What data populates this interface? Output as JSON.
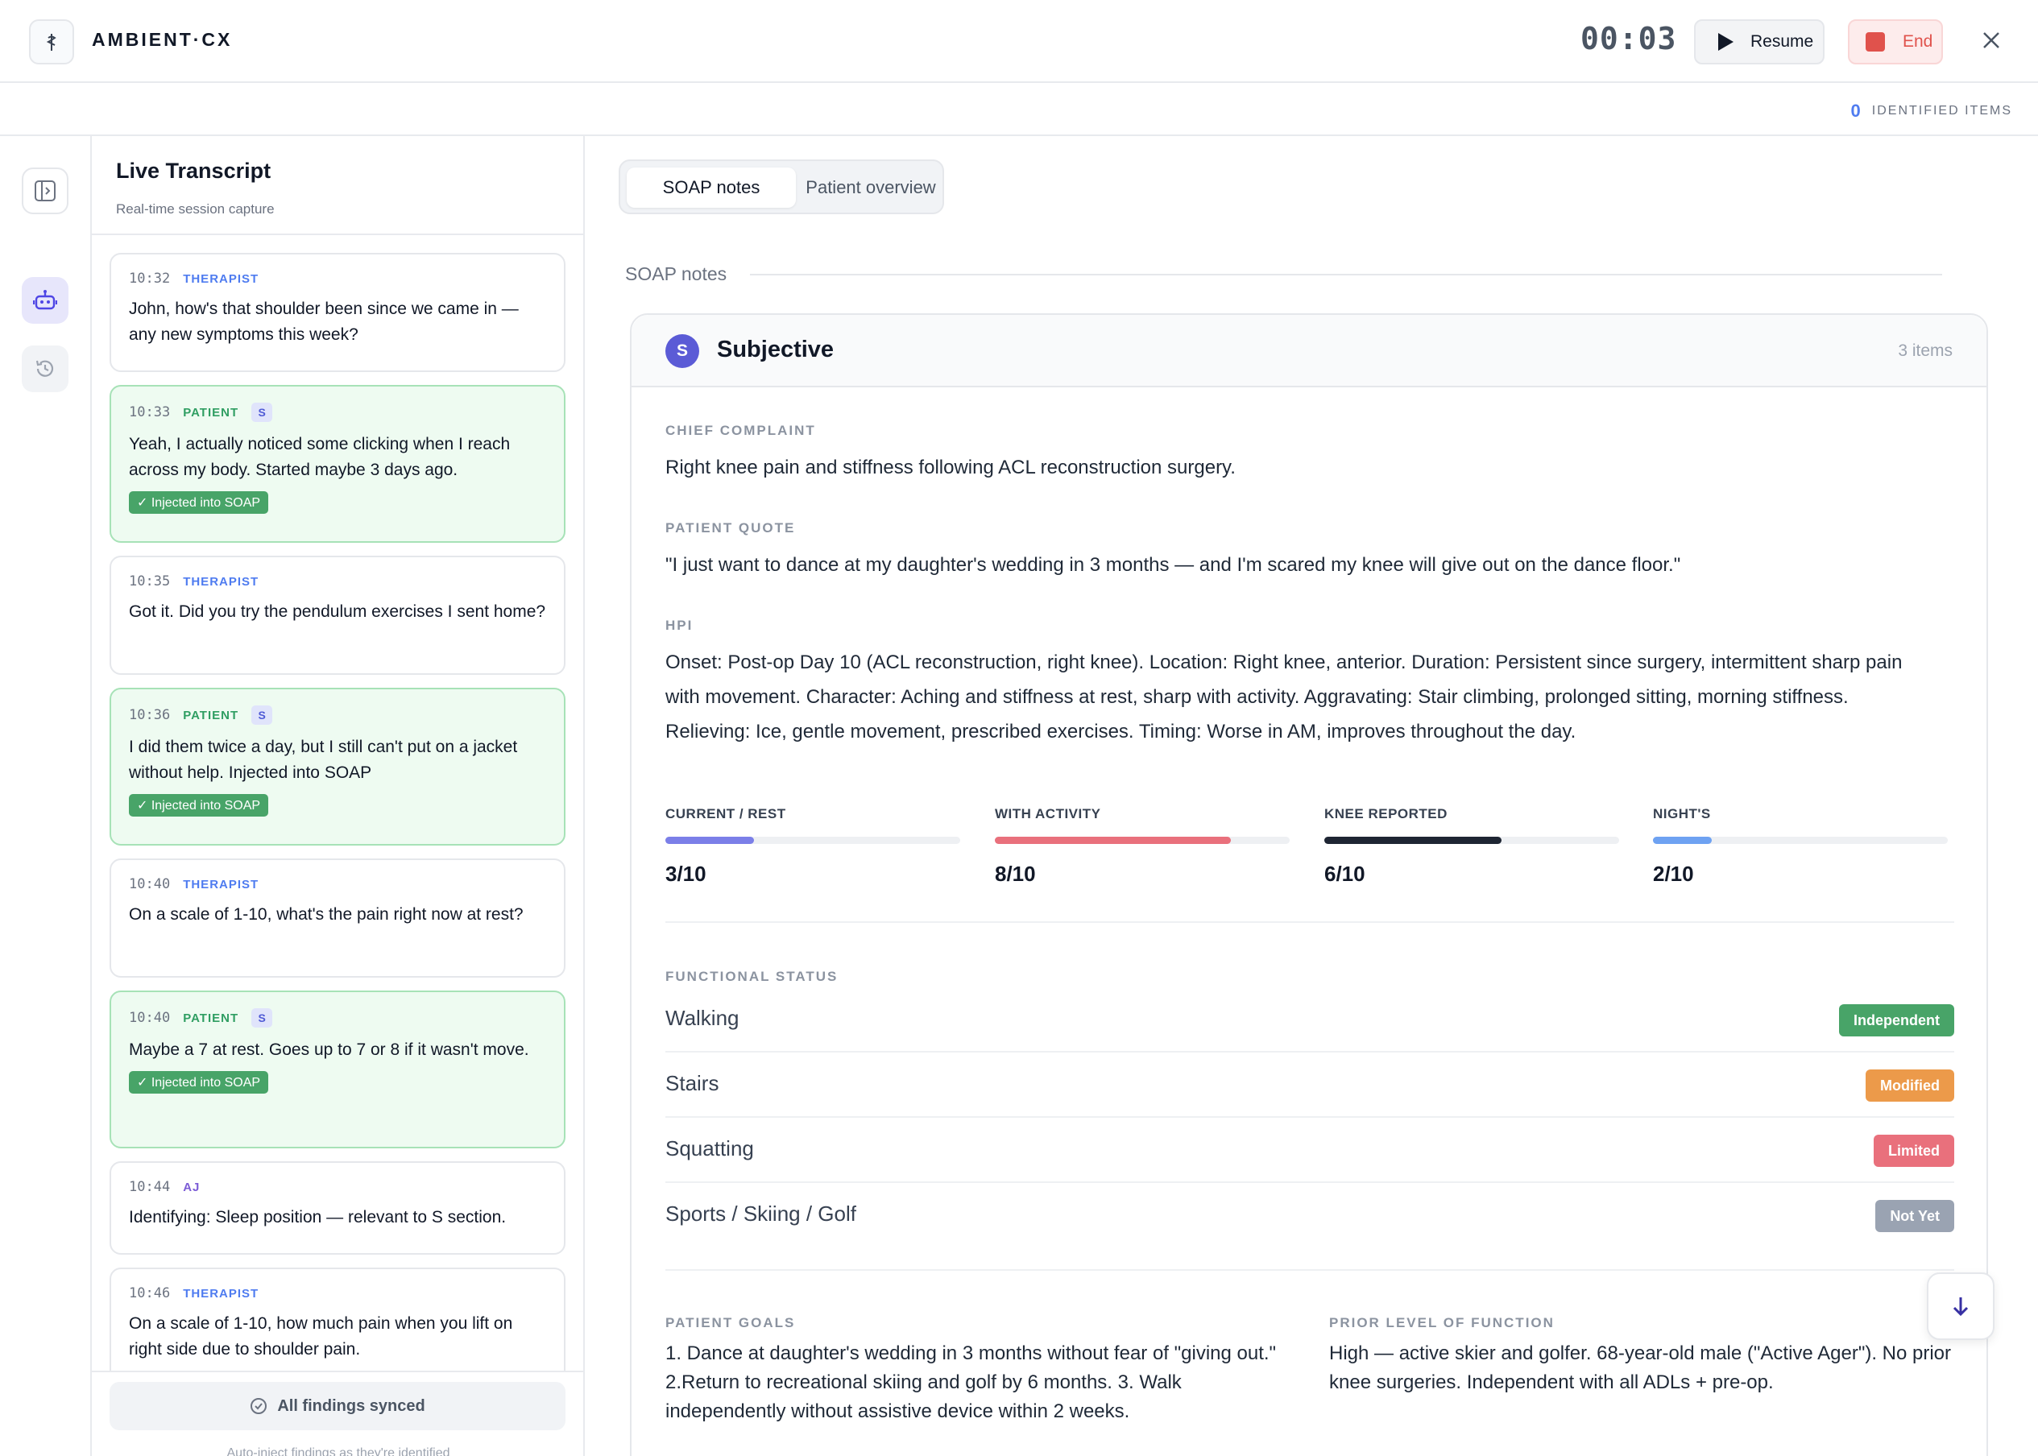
{
  "header": {
    "brand": "AMBIENT·CX",
    "timer": "00:03",
    "resume_label": "Resume",
    "end_label": "End",
    "identified_count": "0",
    "identified_label": "IDENTIFIED ITEMS"
  },
  "transcript": {
    "title": "Live Transcript",
    "subtitle": "Real-time session capture",
    "messages": [
      {
        "time": "10:32",
        "role": "THERAPIST",
        "text": "John, how's that shoulder been since we came in — any new symptoms this week?"
      },
      {
        "time": "10:33",
        "role": "PATIENT",
        "chip": "S",
        "text": "Yeah, I actually noticed some clicking when I reach across my body. Started maybe 3 days ago.",
        "injected": "✓ Injected into SOAP"
      },
      {
        "time": "10:35",
        "role": "THERAPIST",
        "text": "Got it. Did you try the pendulum exercises I sent home?"
      },
      {
        "time": "10:36",
        "role": "PATIENT",
        "chip": "S",
        "text": "I did them twice a day, but I still can't put on a jacket without help. Injected into SOAP",
        "injected": "✓ Injected into SOAP"
      },
      {
        "time": "10:40",
        "role": "THERAPIST",
        "text": "On a scale of 1-10, what's the pain right now at rest?"
      },
      {
        "time": "10:40",
        "role": "PATIENT",
        "chip": "S",
        "text": "Maybe a 7 at rest. Goes up to 7 or 8 if it wasn't move.",
        "injected": "✓ Injected into SOAP"
      },
      {
        "time": "10:44",
        "role": "AJ",
        "text": "Identifying: Sleep position — relevant to S section."
      },
      {
        "time": "10:46",
        "role": "THERAPIST",
        "text": "On a scale of 1-10, how much pain when you lift on right side due to shoulder pain."
      }
    ],
    "synced_label": "All findings synced",
    "footer_note": "Auto-inject findings as they're identified"
  },
  "tabs": {
    "soap": "SOAP notes",
    "overview": "Patient overview"
  },
  "main": {
    "section_label": "SOAP notes",
    "card": {
      "badge_letter": "S",
      "title": "Subjective",
      "count": "3 items",
      "chief_complaint_label": "CHIEF COMPLAINT",
      "chief_complaint": "Right knee pain and stiffness following ACL reconstruction surgery.",
      "patient_quote_label": "PATIENT QUOTE",
      "patient_quote": "\"I just want to dance at my daughter's wedding in 3 months — and I'm scared my knee will give out on the dance floor.\"",
      "hpi_label": "HPI",
      "hpi": "Onset: Post-op Day 10 (ACL reconstruction, right knee). Location: Right knee, anterior. Duration: Persistent since surgery, intermittent sharp pain with movement. Character: Aching and stiffness at rest, sharp with activity. Aggravating: Stair climbing, prolonged sitting, morning stiffness. Relieving: Ice, gentle movement, prescribed exercises. Timing: Worse in AM, improves throughout the day.",
      "pain": [
        {
          "label": "CURRENT / REST",
          "value": "3/10",
          "level": 0.3,
          "color": "#7b7fe8"
        },
        {
          "label": "WITH ACTIVITY",
          "value": "8/10",
          "level": 0.8,
          "color": "#e9707c"
        },
        {
          "label": "KNEE REPORTED",
          "value": "6/10",
          "level": 0.6,
          "color": "#1e2533"
        },
        {
          "label": "NIGHT'S",
          "value": "2/10",
          "level": 0.2,
          "color": "#6ea2f2"
        }
      ],
      "functional_label": "FUNCTIONAL STATUS",
      "functional": [
        {
          "name": "Walking",
          "status": "Independent",
          "color": "#48a468"
        },
        {
          "name": "Stairs",
          "status": "Modified",
          "color": "#ec9a4a"
        },
        {
          "name": "Squatting",
          "status": "Limited",
          "color": "#e9707c"
        },
        {
          "name": "Sports / Skiing / Golf",
          "status": "Not Yet",
          "color": "#9aa3b2"
        }
      ],
      "goals_label": "PATIENT GOALS",
      "goals": "1. Dance at daughter's wedding in 3 months without fear of \"giving out.\" 2.Return to recreational skiing and golf by 6 months. 3. Walk independently without assistive device within 2 weeks.",
      "prior_label": "PRIOR LEVEL OF FUNCTION",
      "prior": "High — active skier and golfer. 68-year-old male (\"Active Ager\"). No prior knee surgeries. Independent with all ADLs + pre-op."
    }
  }
}
